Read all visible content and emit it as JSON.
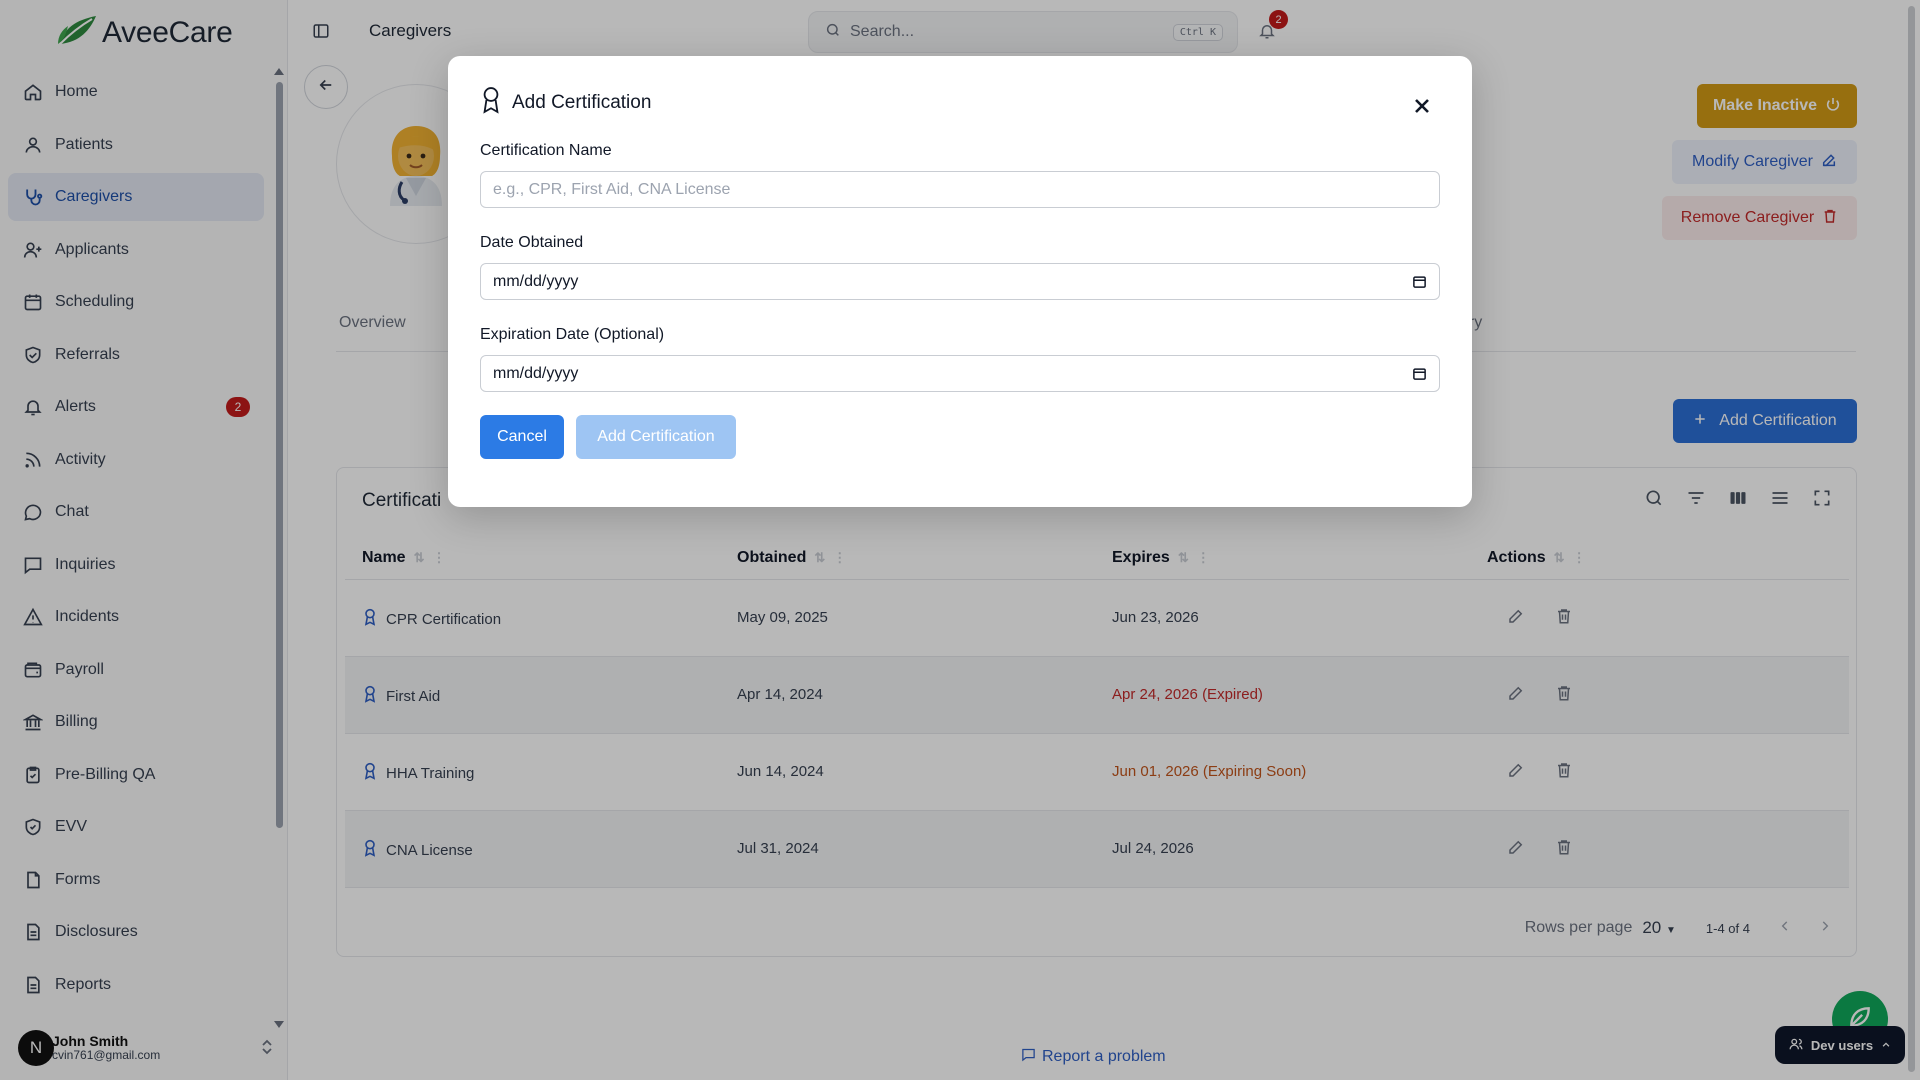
{
  "brand": {
    "name": "AveeCare",
    "color": "#2f8a3f"
  },
  "sidebar": {
    "items": [
      {
        "label": "Home",
        "icon": "home-icon"
      },
      {
        "label": "Patients",
        "icon": "user-icon"
      },
      {
        "label": "Caregivers",
        "icon": "stethoscope-icon",
        "active": true
      },
      {
        "label": "Applicants",
        "icon": "user-plus-icon"
      },
      {
        "label": "Scheduling",
        "icon": "calendar-icon"
      },
      {
        "label": "Referrals",
        "icon": "shield-check-icon"
      },
      {
        "label": "Alerts",
        "icon": "bell-icon",
        "badge": "2"
      },
      {
        "label": "Activity",
        "icon": "rss-icon"
      },
      {
        "label": "Chat",
        "icon": "message-circle-icon"
      },
      {
        "label": "Inquiries",
        "icon": "message-square-icon"
      },
      {
        "label": "Incidents",
        "icon": "alert-triangle-icon"
      },
      {
        "label": "Payroll",
        "icon": "wallet-icon"
      },
      {
        "label": "Billing",
        "icon": "bank-icon"
      },
      {
        "label": "Pre-Billing QA",
        "icon": "clipboard-check-icon"
      },
      {
        "label": "EVV",
        "icon": "shield-icon"
      },
      {
        "label": "Forms",
        "icon": "file-icon"
      },
      {
        "label": "Disclosures",
        "icon": "file-text-icon"
      },
      {
        "label": "Reports",
        "icon": "file-text-icon"
      }
    ],
    "user": {
      "initial": "N",
      "name": "John Smith",
      "email": "cvin761@gmail.com"
    }
  },
  "topbar": {
    "breadcrumb": "Caregivers",
    "search_placeholder": "Search...",
    "search_shortcut": "Ctrl K",
    "notification_count": "2"
  },
  "profile": {
    "actions": {
      "make_inactive": "Make Inactive",
      "modify": "Modify Caregiver",
      "remove": "Remove Caregiver"
    },
    "tabs": [
      {
        "label": "Overview"
      },
      {
        "label": "ory"
      }
    ],
    "add_certification_label": "Add Certification"
  },
  "table": {
    "title": "Certificati",
    "columns": [
      "Name",
      "Obtained",
      "Expires",
      "Actions"
    ],
    "rows": [
      {
        "name": "CPR Certification",
        "obtained": "May 09, 2025",
        "expires": "Jun 23, 2026",
        "status": "ok"
      },
      {
        "name": "First Aid",
        "obtained": "Apr 14, 2024",
        "expires": "Apr 24, 2026 (Expired)",
        "status": "expired"
      },
      {
        "name": "HHA Training",
        "obtained": "Jun 14, 2024",
        "expires": "Jun 01, 2026 (Expiring Soon)",
        "status": "expiring"
      },
      {
        "name": "CNA License",
        "obtained": "Jul 31, 2024",
        "expires": "Jul 24, 2026",
        "status": "ok"
      }
    ],
    "pagination": {
      "rows_per_page_label": "Rows per page",
      "rows_per_page": "20",
      "range": "1-4 of 4"
    }
  },
  "footer": {
    "report_problem": "Report a problem",
    "dev_users": "Dev users"
  },
  "modal": {
    "title": "Add Certification",
    "fields": {
      "name_label": "Certification Name",
      "name_placeholder": "e.g., CPR, First Aid, CNA License",
      "date_obtained_label": "Date Obtained",
      "date_obtained_value": "mm/dd/yyyy",
      "expiration_label": "Expiration Date (Optional)",
      "expiration_value": "mm/dd/yyyy"
    },
    "cancel_label": "Cancel",
    "submit_label": "Add Certification"
  },
  "colors": {
    "primary": "#2c7be5",
    "primary_disabled": "#9ec5f3",
    "warning": "#d19a16",
    "danger": "#c22a2a",
    "expiring": "#c2551c",
    "success": "#10a85a"
  }
}
